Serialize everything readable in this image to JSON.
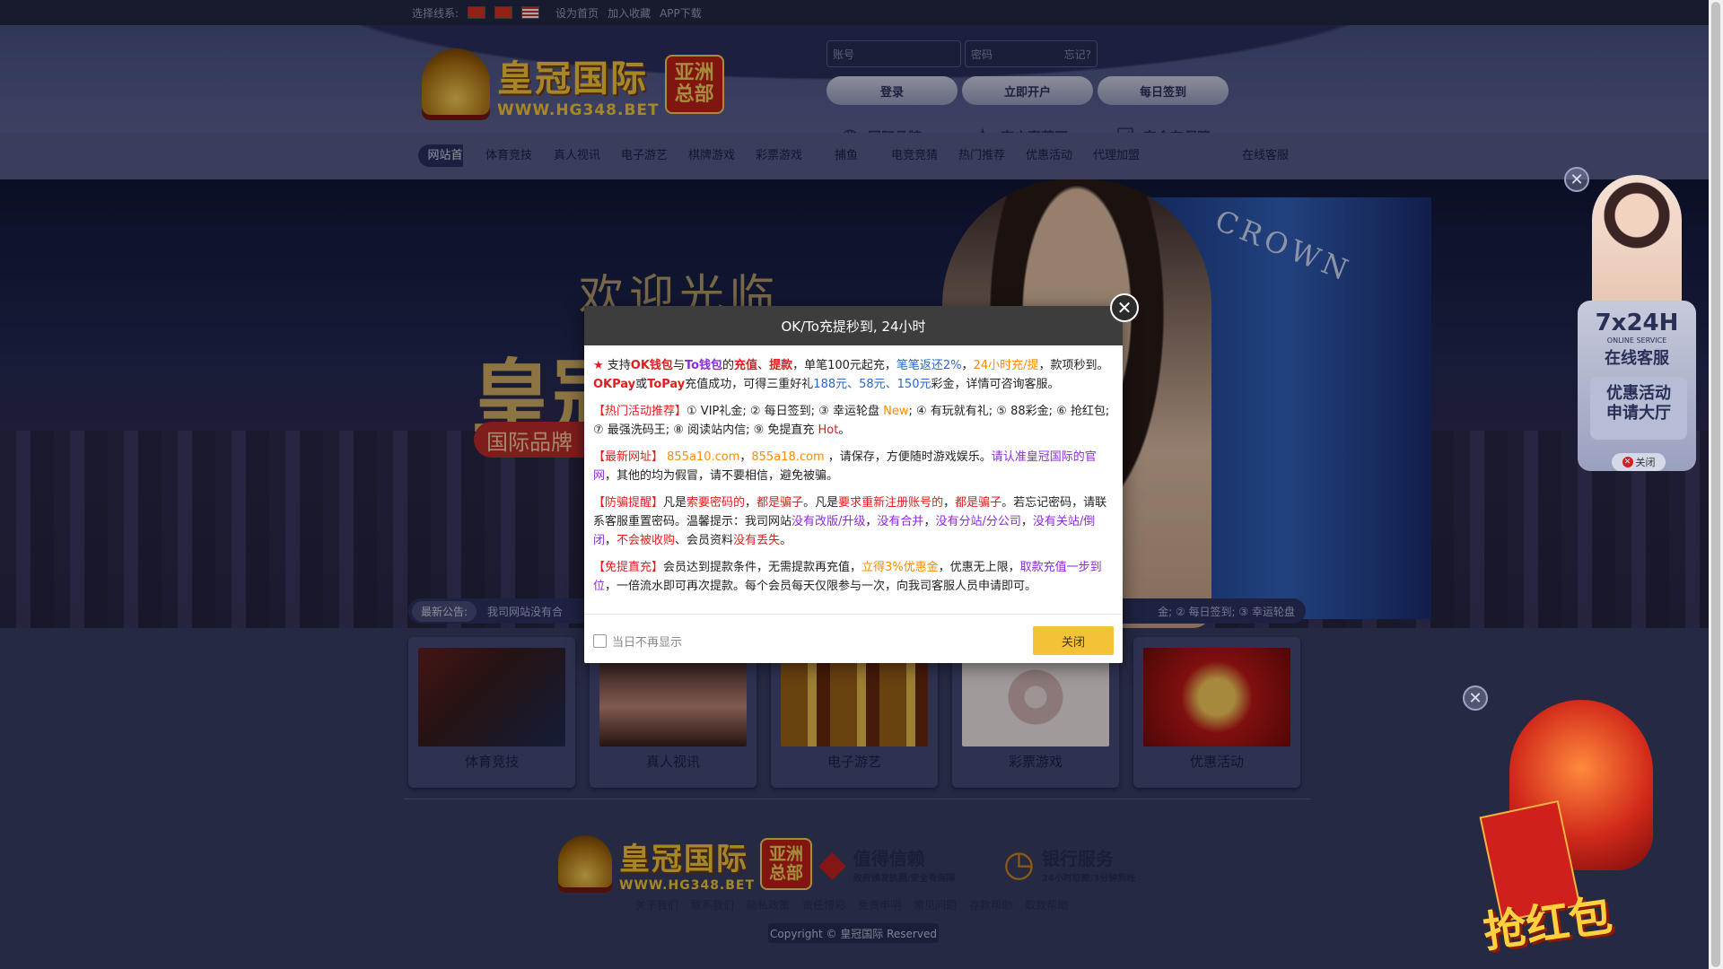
{
  "topbar": {
    "line_label": "选择线系:",
    "links": [
      "设为首页",
      "加入收藏",
      "APP下载"
    ]
  },
  "header": {
    "logo_cn": "皇冠国际",
    "logo_url": "WWW.HG348.BET",
    "logo_badge_top": "亚洲",
    "logo_badge_bottom": "总部",
    "account_placeholder": "账号",
    "password_placeholder": "密码",
    "forgot": "忘记?",
    "login": "登录",
    "register": "立即开户",
    "checkin": "每日签到",
    "features": [
      "国际品牌",
      "官方直营网",
      "安全有保障"
    ]
  },
  "nav": {
    "items": [
      "网站首页",
      "体育竞技",
      "真人视讯",
      "电子游艺",
      "棋牌游戏",
      "彩票游戏",
      "捕鱼",
      "电竞竞猜",
      "热门推荐",
      "优惠活动",
      "代理加盟",
      "在线客服"
    ]
  },
  "banner": {
    "welcome": "欢迎光临",
    "title": "皇冠",
    "tag": "国际品牌",
    "hotel_sign": "CROWN"
  },
  "notice": {
    "label": "最新公告:",
    "text": "我司网站没有合",
    "text_tail": "金; ② 每日签到; ③ 幸运轮盘"
  },
  "cards": [
    "体育竞技",
    "真人视讯",
    "电子游艺",
    "彩票游戏",
    "优惠活动"
  ],
  "footer": {
    "trust1_big": "值得信赖",
    "trust1_small": "政府颁发执照/安全有保障",
    "trust2_big": "银行服务",
    "trust2_small": "24小时取款/3分钟到帐",
    "links": [
      "关于我们",
      "联系我们",
      "隐私政策",
      "责任博彩",
      "免责申明",
      "常见问题",
      "存款帮助",
      "取款帮助"
    ],
    "copyright": "Copyright © 皇冠国际 Reserved"
  },
  "side_cs": {
    "hours": "7x24H",
    "online_service_en": "ONLINE SERVICE",
    "online_service": "在线客服",
    "promo_line1": "优惠活动",
    "promo_line2": "申请大厅",
    "close": "关闭"
  },
  "red_envelope": {
    "label": "抢红包"
  },
  "modal": {
    "title": "OK/To充提秒到, 24小时",
    "p1": {
      "a": "★",
      "b": " 支持",
      "c": "OK钱包",
      "d": "与",
      "e": "To钱包",
      "f": "的",
      "g": "充值",
      "h": "、",
      "i": "提款",
      "j": "，单笔100元起充，",
      "k": "笔笔返还2%",
      "l": "，",
      "m": "24小时充/提",
      "n": "，款项秒到。",
      "o": "OKPay",
      "p": "或",
      "q": "ToPay",
      "r": "充值成功，可得三重好礼",
      "s": "188元、58元、150元",
      "t": "彩金，详情可咨询客服。"
    },
    "p2": {
      "label": "【热门活动推荐】",
      "a": "① VIP礼金; ② 每日签到; ③ 幸运轮盘 ",
      "new": "New",
      "b": "; ④ 有玩就有礼; ⑤ 88彩金; ⑥ 抢红包; ⑦ 最强洗码王; ⑧ 阅读站内信; ⑨ 免提直充 ",
      "hot": "Hot",
      "c": "。"
    },
    "p3": {
      "label": "【最新网址】",
      "url1": " 855a10.com",
      "sep": "，",
      "url2": "855a18.com",
      "a": " ，请保存，方便随时游戏娱乐。",
      "b": "请认准皇冠国际的官网",
      "c": "，其他的均为假冒，请不要相信，避免被骗。"
    },
    "p4": {
      "label": "【防骗提醒】",
      "a": "凡是",
      "b": "索要密码的",
      "c": "，",
      "d": "都是骗子",
      "e": "。凡是",
      "f": "要求重新注册账号的",
      "g": "，",
      "h": "都是骗子",
      "i": "。若忘记密码，请联系客服重置密码。温馨提示：我司网站",
      "j": "没有改版/升级",
      "k": "，",
      "l": "没有合并",
      "m": "，",
      "n": "没有分站/分公司",
      "o": "，",
      "p": "没有关站/倒闭",
      "q": "，",
      "r": "不会被收购",
      "s": "、会员资料",
      "t": "没有丢失",
      "u": "。"
    },
    "p5": {
      "label": "【免提直充】",
      "a": "会员达到提款条件，无需提款再充值，",
      "b": "立得3%优惠金",
      "c": "，优惠无上限，",
      "d": "取款充值一步到位",
      "e": "，一倍流水即可再次提款。每个会员每天仅限参与一次，向我司客服人员申请即可。"
    },
    "dont_show": "当日不再显示",
    "close_button": "关闭"
  }
}
